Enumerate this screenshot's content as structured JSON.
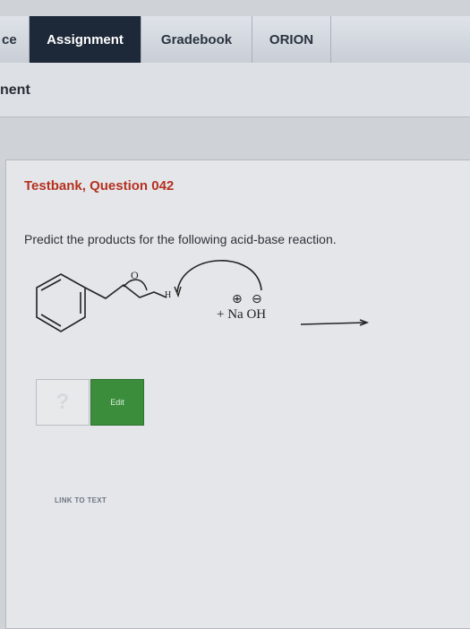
{
  "tabs": {
    "partial_left": "ce",
    "assignment": "Assignment",
    "gradebook": "Gradebook",
    "orion": "ORION"
  },
  "header": {
    "title_fragment": "nent"
  },
  "question": {
    "title": "Testbank, Question 042",
    "prompt": "Predict the products for the following acid-base reaction.",
    "reagent": "+ Na OH",
    "oxygen_label": "O",
    "hydrogen_label": "H",
    "plus_charge": "⊕",
    "minus_charge": "⊖"
  },
  "answer": {
    "placeholder": "?",
    "edit_label": "Edit"
  },
  "links": {
    "link_to_text": "LINK TO TEXT"
  }
}
